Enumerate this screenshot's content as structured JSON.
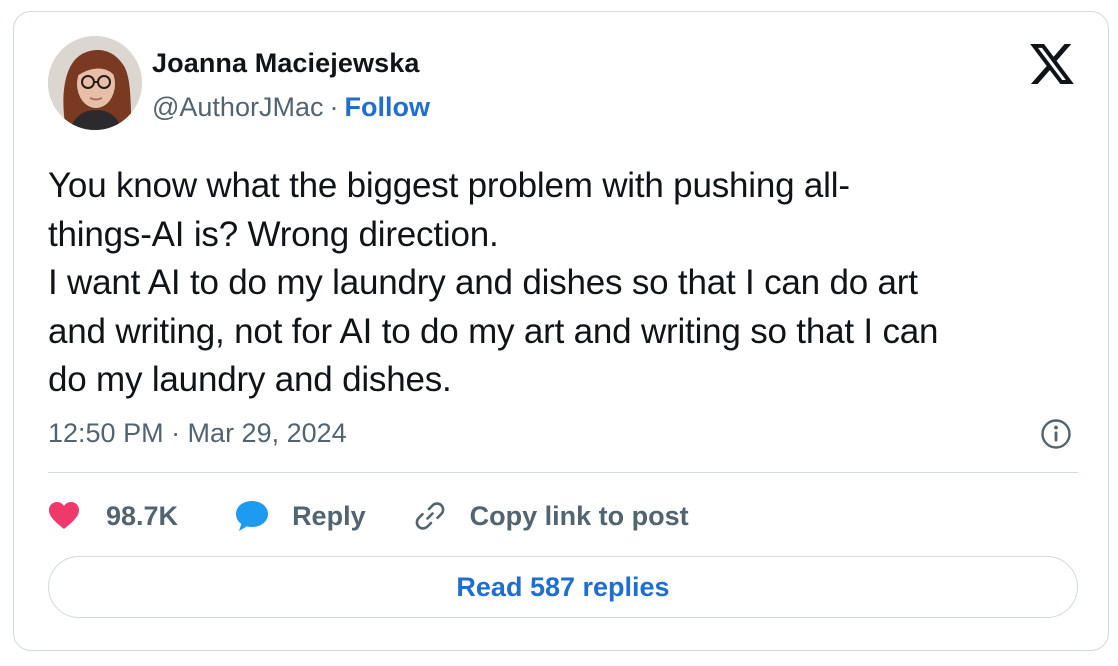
{
  "author": {
    "name": "Joanna Maciejewska",
    "handle": "@AuthorJMac",
    "separator": "·",
    "follow_label": "Follow"
  },
  "tweet": {
    "text": "You know what the biggest problem with pushing all-\nthings-AI is? Wrong direction.\nI want AI to do my laundry and dishes so that I can do art\nand writing, not for AI to do my art and writing so that I can\ndo my laundry and dishes.",
    "timestamp": "12:50 PM · Mar 29, 2024"
  },
  "actions": {
    "likes_count": "98.7K",
    "reply_label": "Reply",
    "copy_link_label": "Copy link to post"
  },
  "footer": {
    "read_replies_label": "Read 587 replies"
  },
  "icons": {
    "brand": "x-logo-icon",
    "like": "heart-icon",
    "reply": "speech-bubble-icon",
    "copy": "link-icon",
    "info": "info-icon"
  },
  "colors": {
    "text": "#0f1419",
    "secondary_text": "#536471",
    "accent_blue": "#1d6fd1",
    "like_red": "#f91880",
    "reply_blue": "#1d9bf0",
    "border": "#cfd9de"
  }
}
